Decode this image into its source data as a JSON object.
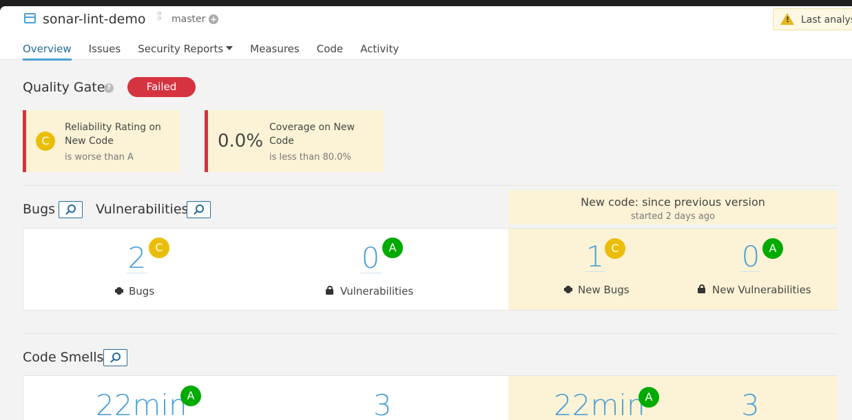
{
  "header": {
    "project_name": "sonar-lint-demo",
    "branch": "master",
    "warning": "Last analysis"
  },
  "nav": {
    "tabs": [
      {
        "label": "Overview"
      },
      {
        "label": "Issues"
      },
      {
        "label": "Security Reports"
      },
      {
        "label": "Measures"
      },
      {
        "label": "Code"
      },
      {
        "label": "Activity"
      }
    ]
  },
  "quality_gate": {
    "title": "Quality Gate",
    "status": "Failed",
    "conditions": [
      {
        "rating": "C",
        "label": "Reliability Rating on New Code",
        "detail": "is worse than A"
      },
      {
        "value": "0.0%",
        "label": "Coverage on New Code",
        "detail": "is less than 80.0%"
      }
    ]
  },
  "bugs_section": {
    "title_bugs": "Bugs",
    "title_vulns": "Vulnerabilities",
    "new_code_title": "New code: since previous version",
    "new_code_sub": "started 2 days ago",
    "bugs": {
      "value": "2",
      "rating": "C",
      "label": "Bugs"
    },
    "vulnerabilities": {
      "value": "0",
      "rating": "A",
      "label": "Vulnerabilities"
    },
    "new_bugs": {
      "value": "1",
      "rating": "C",
      "label": "New Bugs"
    },
    "new_vulnerabilities": {
      "value": "0",
      "rating": "A",
      "label": "New Vulnerabilities"
    }
  },
  "smells_section": {
    "title": "Code Smells",
    "debt": {
      "value": "22min",
      "rating": "A"
    },
    "smells": {
      "value": "3"
    },
    "new_debt": {
      "value": "22min",
      "rating": "A"
    },
    "new_smells": {
      "value": "3"
    }
  },
  "colors": {
    "accent": "#4b9fd5",
    "failed": "#d4333f",
    "rating_a": "#00aa00",
    "rating_c": "#eabe06",
    "new_code_bg": "#fcf3d6"
  }
}
